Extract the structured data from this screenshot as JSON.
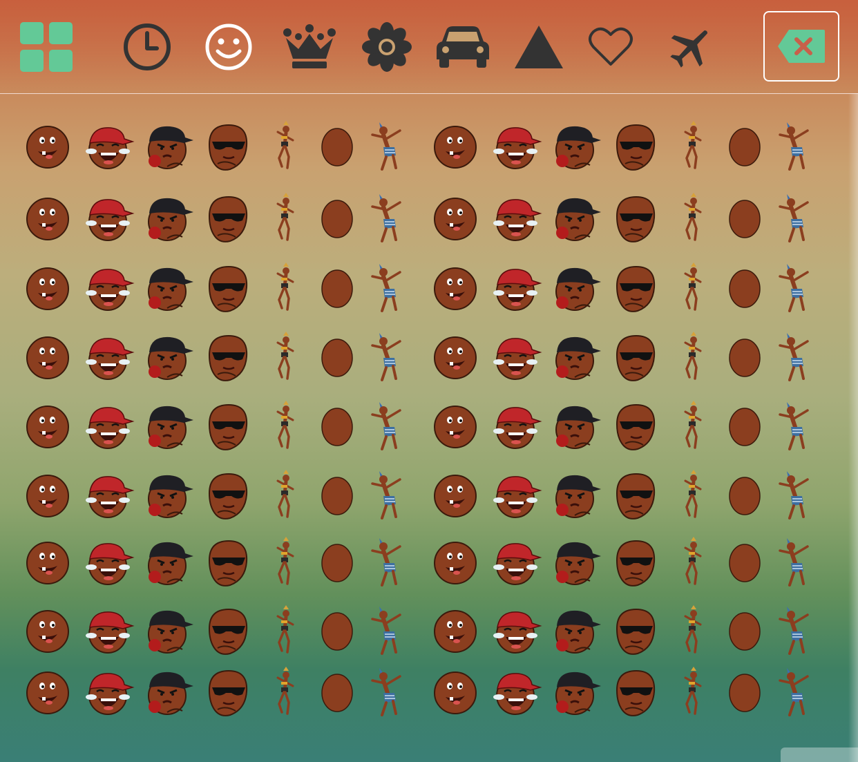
{
  "toolbar": {
    "categories": [
      {
        "icon": "grid-icon",
        "active": true,
        "color": "#63c997"
      },
      {
        "icon": "clock-icon",
        "active": false,
        "color": "#333333"
      },
      {
        "icon": "smiley-icon",
        "active": false,
        "color": "#ffffff"
      },
      {
        "icon": "crown-icon",
        "active": false,
        "color": "#333333"
      },
      {
        "icon": "flower-icon",
        "active": false,
        "color": "#333333"
      },
      {
        "icon": "car-icon",
        "active": false,
        "color": "#333333"
      },
      {
        "icon": "triangle-icon",
        "active": false,
        "color": "#333333"
      },
      {
        "icon": "heart-icon",
        "active": false,
        "color": "#333333"
      },
      {
        "icon": "airplane-icon",
        "active": false,
        "color": "#333333"
      }
    ],
    "delete_button": {
      "icon": "backspace-icon",
      "color": "#63c997"
    }
  },
  "emoji_grid": {
    "rows": 9,
    "columns": 14,
    "pattern": [
      "surprised-face-emoji",
      "red-cap-laughing-emoji",
      "black-cap-angry-emoji",
      "sunglasses-bald-emoji",
      "dancing-woman-emoji",
      "blank-brown-oval-emoji",
      "dancing-man-emoji"
    ]
  },
  "colors": {
    "accent": "#63c997",
    "skin": "#8b3e1f",
    "cap_red": "#c0262a",
    "cap_black": "#1f1f24"
  }
}
